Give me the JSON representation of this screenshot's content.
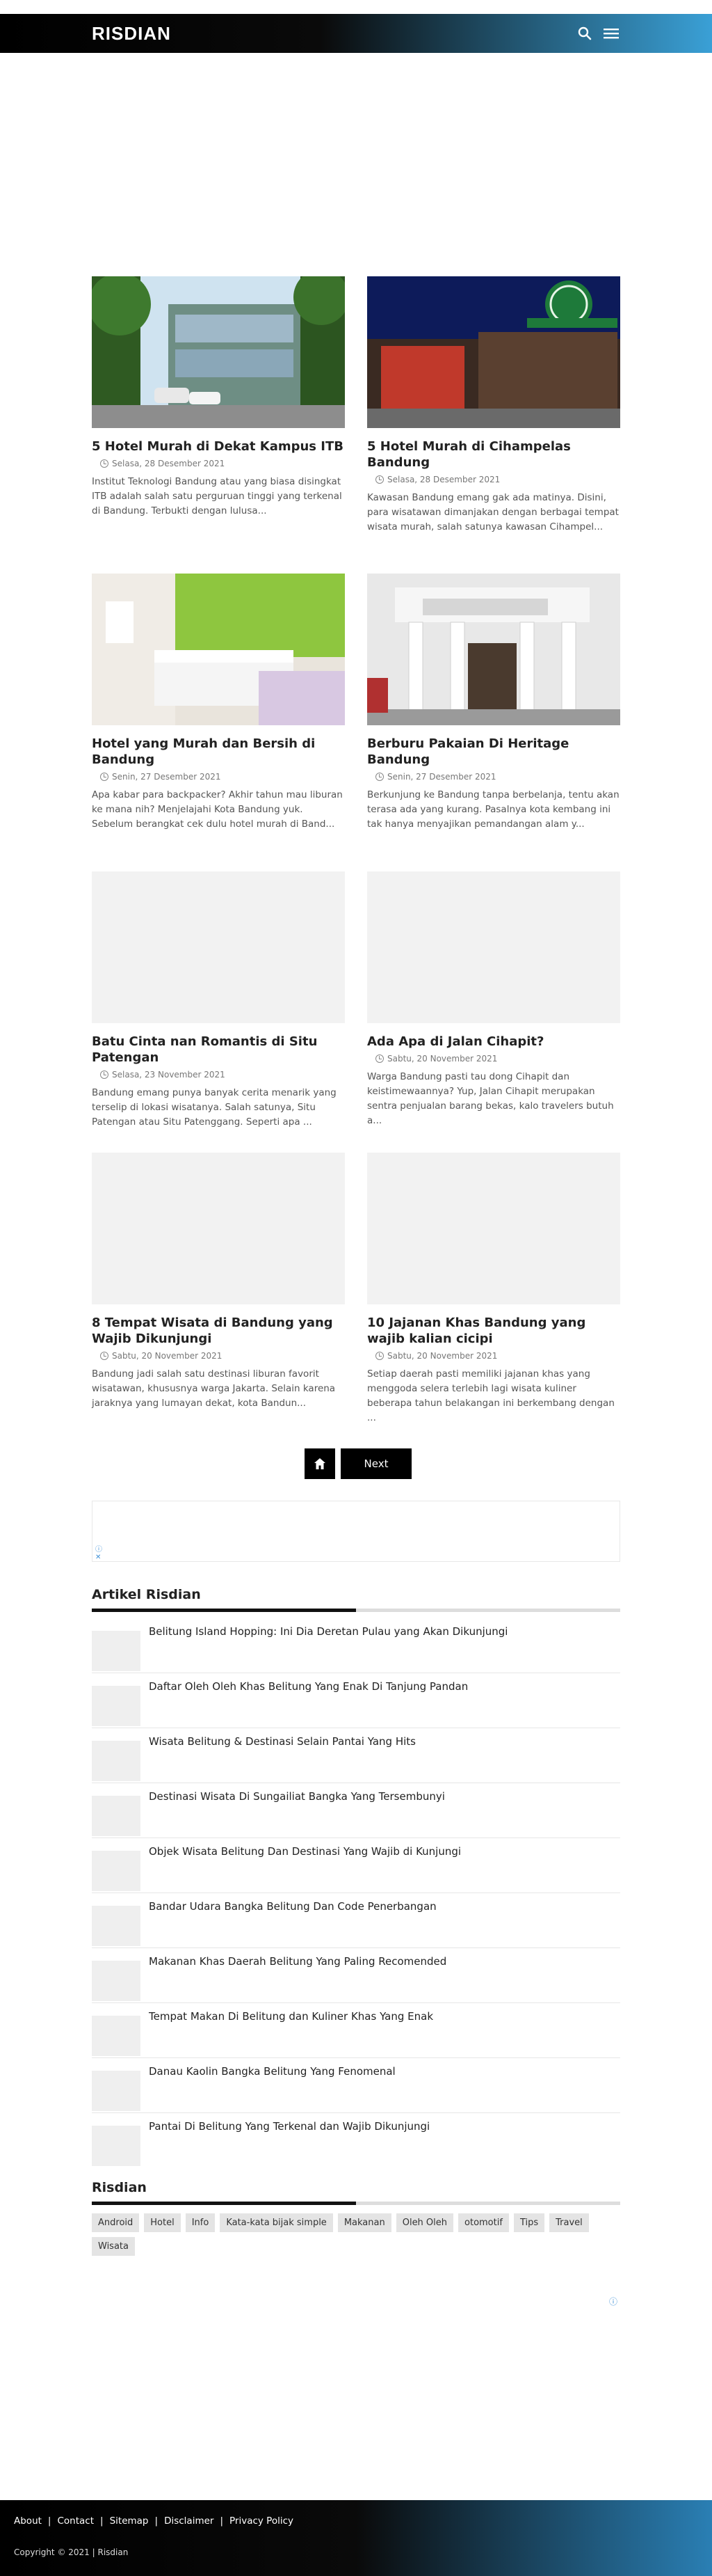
{
  "header": {
    "brand": "RISDIAN"
  },
  "posts": [
    {
      "title": "5 Hotel Murah di Dekat Kampus ITB",
      "date": "Selasa, 28 Desember 2021",
      "excerpt": "Institut Teknologi Bandung atau yang biasa disingkat ITB adalah salah satu perguruan tinggi yang terkenal di Bandung. Terbukti dengan lulusa..."
    },
    {
      "title": "5 Hotel Murah di Cihampelas Bandung",
      "date": "Selasa, 28 Desember 2021",
      "excerpt": "Kawasan Bandung emang gak ada matinya. Disini, para wisatawan dimanjakan dengan berbagai tempat wisata murah, salah satunya kawasan Cihampel..."
    },
    {
      "title": "Hotel yang Murah dan Bersih di Bandung",
      "date": "Senin, 27 Desember 2021",
      "excerpt": "Apa kabar para backpacker? Akhir tahun mau liburan ke mana nih? Menjelajahi Kota Bandung yuk. Sebelum berangkat cek dulu hotel murah di Band..."
    },
    {
      "title": "Berburu Pakaian Di Heritage Bandung",
      "date": "Senin, 27 Desember 2021",
      "excerpt": "Berkunjung ke Bandung tanpa berbelanja, tentu akan terasa ada yang kurang. Pasalnya kota kembang ini tak hanya menyajikan pemandangan alam y..."
    },
    {
      "title": "Batu Cinta nan Romantis di Situ Patengan",
      "date": "Selasa, 23 November 2021",
      "excerpt": "Bandung emang punya banyak cerita menarik yang terselip di lokasi wisatanya. Salah satunya, Situ Patengan atau Situ Patenggang. Seperti apa ..."
    },
    {
      "title": "Ada Apa di Jalan Cihapit?",
      "date": "Sabtu, 20 November 2021",
      "excerpt": "Warga Bandung pasti tau dong Cihapit dan keistimewaannya? Yup, Jalan Cihapit merupakan sentra penjualan barang bekas, kalo travelers butuh a..."
    },
    {
      "title": "8 Tempat Wisata di Bandung yang Wajib Dikunjungi",
      "date": "Sabtu, 20 November 2021",
      "excerpt": "Bandung jadi salah satu destinasi liburan favorit wisatawan, khususnya warga Jakarta. Selain karena jaraknya yang lumayan dekat, kota Bandun..."
    },
    {
      "title": "10 Jajanan Khas Bandung yang wajib kalian cicipi",
      "date": "Sabtu, 20 November 2021",
      "excerpt": "Setiap daerah pasti memiliki jajanan khas yang menggoda selera terlebih lagi wisata kuliner beberapa tahun belakangan ini berkembang dengan ..."
    }
  ],
  "pager": {
    "next": "Next"
  },
  "articles_section": {
    "title": "Artikel Risdian",
    "items": [
      "Belitung Island Hopping: Ini Dia Deretan Pulau yang Akan Dikunjungi",
      "Daftar Oleh Oleh Khas Belitung Yang Enak Di Tanjung Pandan",
      "Wisata Belitung & Destinasi Selain Pantai Yang Hits",
      "Destinasi Wisata Di Sungailiat Bangka Yang Tersembunyi",
      "Objek Wisata Belitung Dan Destinasi Yang Wajib di Kunjungi",
      "Bandar Udara Bangka Belitung Dan Code Penerbangan",
      "Makanan Khas Daerah Belitung Yang Paling Recomended",
      "Tempat Makan Di Belitung dan Kuliner Khas Yang Enak",
      "Danau Kaolin Bangka Belitung Yang Fenomenal",
      "Pantai Di Belitung Yang Terkenal dan Wajib Dikunjungi"
    ]
  },
  "labels_section": {
    "title": "Risdian",
    "tags": [
      "Android",
      "Hotel",
      "Info",
      "Kata-kata bijak simple",
      "Makanan",
      "Oleh Oleh",
      "otomotif",
      "Tips",
      "Travel",
      "Wisata"
    ]
  },
  "footer": {
    "links": [
      "About",
      "Contact",
      "Sitemap",
      "Disclaimer",
      "Privacy Policy"
    ],
    "copyright": "Copyright © 2021 | Risdian"
  },
  "colors": {
    "header_start": "#000000",
    "header_end": "#3aa0d6",
    "accent": "#111111"
  }
}
